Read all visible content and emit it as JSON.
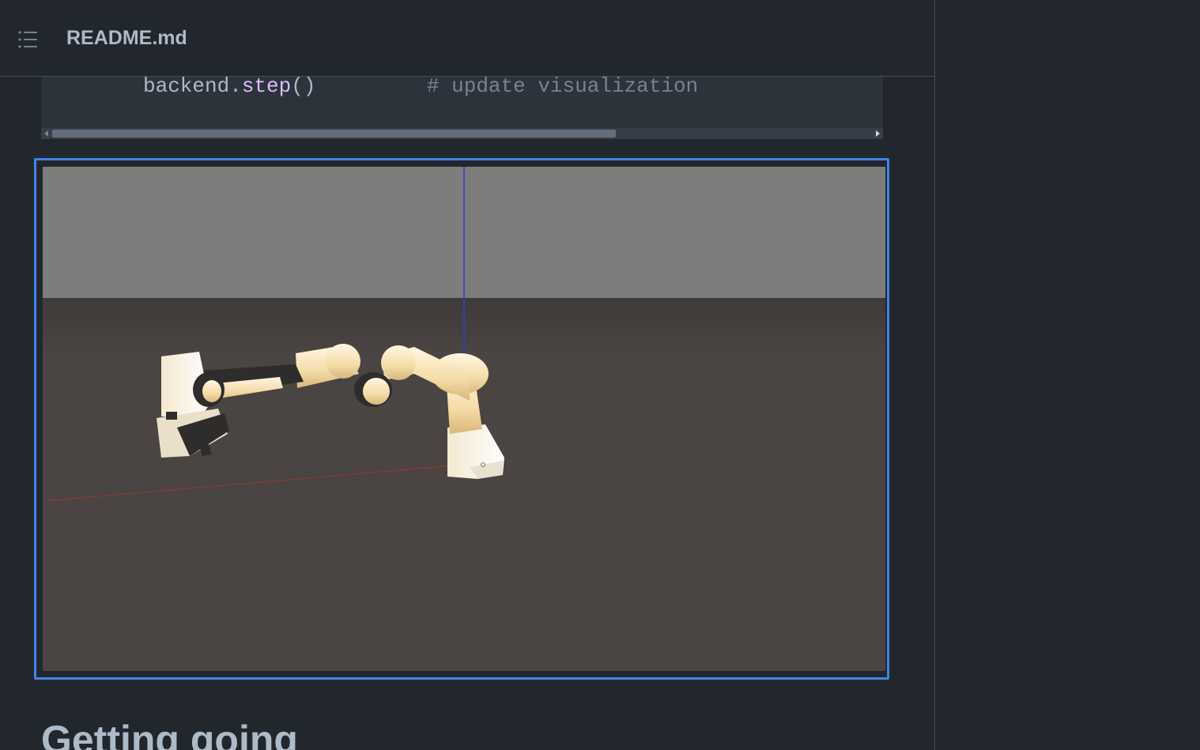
{
  "file_header": {
    "file_name": "README.md",
    "toc_icon": "list-unordered-icon"
  },
  "code_block": {
    "object": "backend",
    "dot": ".",
    "method": "step",
    "parens": "()",
    "spacing": "         ",
    "comment": "# update visualization"
  },
  "image": {
    "description_alt": "robot arm simulation animation",
    "colors": {
      "sky": "#7d7d7d",
      "floor": "#4a4442",
      "robot_body": "#f2e6c8",
      "robot_joint": "#2f2d2b",
      "axis_z": "#2a3fd6",
      "axis_x": "#8a3a2e",
      "frame_border": "#4184e4"
    }
  },
  "heading": {
    "text": "Getting going"
  }
}
